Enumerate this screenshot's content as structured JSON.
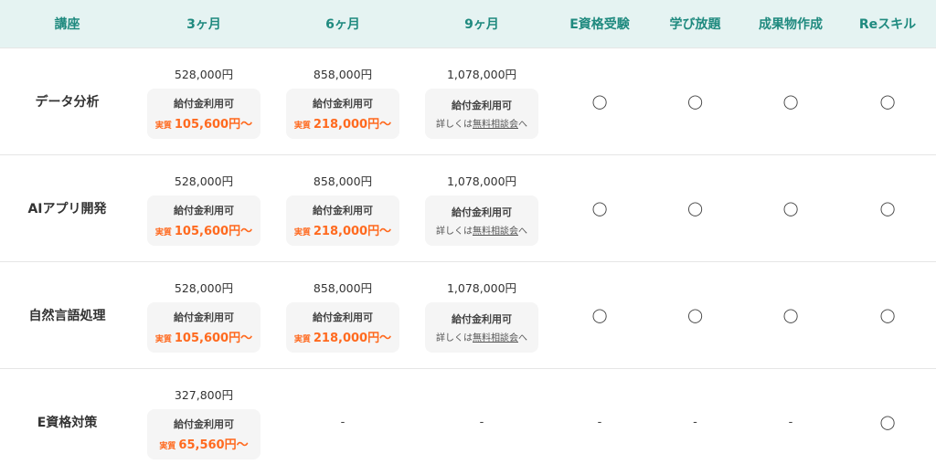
{
  "header": {
    "course": "講座",
    "m3": "3ヶ月",
    "m6": "6ヶ月",
    "m9": "9ヶ月",
    "exam": "E資格受験",
    "unlimited": "学び放題",
    "portfolio": "成果物作成",
    "reskill": "Reスキル"
  },
  "labels": {
    "subsidy": "給付金利用可",
    "net_prefix": "実質",
    "detail_prefix": "詳しくは",
    "detail_link": "無料相談会",
    "detail_suffix": "へ"
  },
  "rows": [
    {
      "course": "データ分析",
      "m3": {
        "price": "528,000円",
        "net": "105,600円〜"
      },
      "m6": {
        "price": "858,000円",
        "net": "218,000円〜"
      },
      "m9": {
        "price": "1,078,000円"
      },
      "exam": "◯",
      "unlimited": "◯",
      "portfolio": "◯",
      "reskill": "◯"
    },
    {
      "course": "AIアプリ開発",
      "m3": {
        "price": "528,000円",
        "net": "105,600円〜"
      },
      "m6": {
        "price": "858,000円",
        "net": "218,000円〜"
      },
      "m9": {
        "price": "1,078,000円"
      },
      "exam": "◯",
      "unlimited": "◯",
      "portfolio": "◯",
      "reskill": "◯"
    },
    {
      "course": "自然言語処理",
      "m3": {
        "price": "528,000円",
        "net": "105,600円〜"
      },
      "m6": {
        "price": "858,000円",
        "net": "218,000円〜"
      },
      "m9": {
        "price": "1,078,000円"
      },
      "exam": "◯",
      "unlimited": "◯",
      "portfolio": "◯",
      "reskill": "◯"
    },
    {
      "course": "E資格対策",
      "m3": {
        "price": "327,800円",
        "net": "65,560円〜"
      },
      "m6": "-",
      "m9": "-",
      "exam": "-",
      "unlimited": "-",
      "portfolio": "-",
      "reskill": "◯"
    }
  ],
  "colors": {
    "header_bg": "#e5f3f2",
    "header_text": "#1f8a7f",
    "accent_orange": "#ff6a1f",
    "box_bg": "#f5f5f5"
  }
}
